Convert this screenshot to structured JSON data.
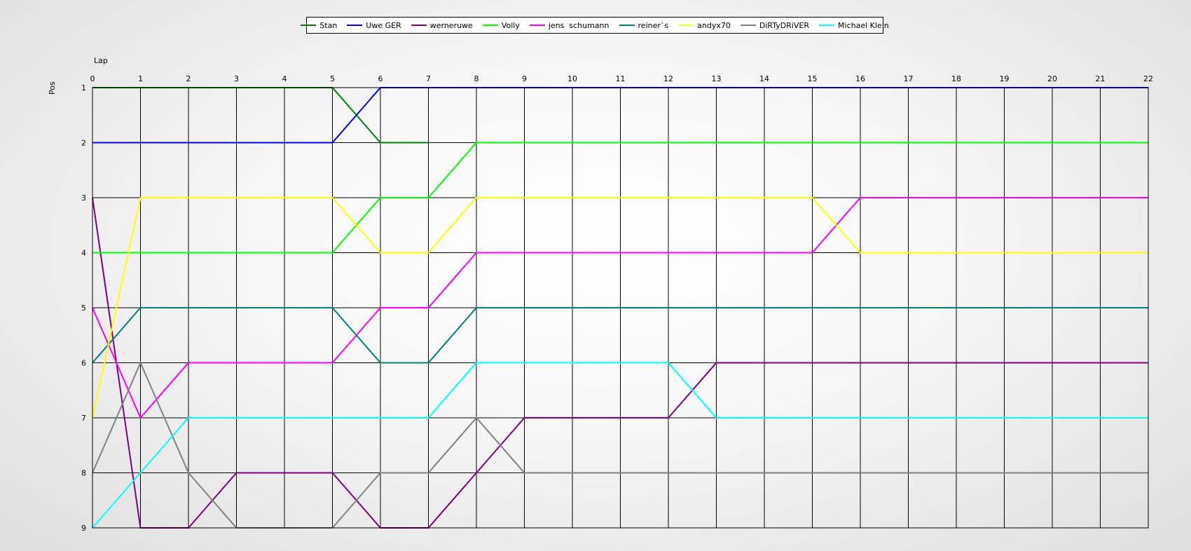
{
  "chart_data": {
    "type": "line",
    "xlabel": "Lap",
    "ylabel": "Pos",
    "x": [
      0,
      1,
      2,
      3,
      4,
      5,
      6,
      7,
      8,
      9,
      10,
      11,
      12,
      13,
      14,
      15,
      16,
      17,
      18,
      19,
      20,
      21,
      22
    ],
    "xlim": [
      0,
      22
    ],
    "ylim": [
      1,
      9
    ],
    "y_inverted": true,
    "y_ticks": [
      1,
      2,
      3,
      4,
      5,
      6,
      7,
      8,
      9
    ],
    "grid": true,
    "legend_position": "top-center",
    "series": [
      {
        "name": "Stan",
        "color": "#008000",
        "values": [
          1,
          1,
          1,
          1,
          1,
          1,
          2,
          2
        ]
      },
      {
        "name": "Uwe GER",
        "color": "#0000ff",
        "values": [
          2,
          2,
          2,
          2,
          2,
          2,
          1,
          1,
          1,
          1,
          1,
          1,
          1,
          1,
          1,
          1,
          1,
          1,
          1,
          1,
          1,
          1,
          1
        ]
      },
      {
        "name": "werneruwe",
        "color": "#800080",
        "values": [
          3,
          9,
          9,
          8,
          8,
          8,
          9,
          9,
          8,
          7,
          7,
          7,
          7,
          6,
          6,
          6,
          6,
          6,
          6,
          6,
          6,
          6,
          6
        ]
      },
      {
        "name": "Volly",
        "color": "#00ff00",
        "values": [
          4,
          4,
          4,
          4,
          4,
          4,
          3,
          3,
          2,
          2,
          2,
          2,
          2,
          2,
          2,
          2,
          2,
          2,
          2,
          2,
          2,
          2,
          2
        ]
      },
      {
        "name": "jens  schumann",
        "color": "#ff00ff",
        "values": [
          5,
          7,
          6,
          6,
          6,
          6,
          5,
          5,
          4,
          4,
          4,
          4,
          4,
          4,
          4,
          4,
          3,
          3,
          3,
          3,
          3,
          3,
          3
        ]
      },
      {
        "name": "reiner`s",
        "color": "#008080",
        "values": [
          6,
          5,
          5,
          5,
          5,
          5,
          6,
          6,
          5,
          5,
          5,
          5,
          5,
          5,
          5,
          5,
          5,
          5,
          5,
          5,
          5,
          5,
          5
        ]
      },
      {
        "name": "andyx70",
        "color": "#ffff00",
        "values": [
          7,
          3,
          3,
          3,
          3,
          3,
          4,
          4,
          3,
          3,
          3,
          3,
          3,
          3,
          3,
          3,
          4,
          4,
          4,
          4,
          4,
          4,
          4
        ]
      },
      {
        "name": "DiRTyDRiVER",
        "color": "#808080",
        "values": [
          8,
          6,
          8,
          9,
          9,
          9,
          8,
          8,
          7,
          8,
          8,
          8,
          8,
          8,
          8,
          8,
          8,
          8,
          8,
          8,
          8,
          8,
          8
        ]
      },
      {
        "name": "Michael Klein",
        "color": "#00ffff",
        "values": [
          9,
          8,
          7,
          7,
          7,
          7,
          7,
          7,
          6,
          6,
          6,
          6,
          6,
          7,
          7,
          7,
          7,
          7,
          7,
          7,
          7,
          7,
          7
        ]
      }
    ]
  }
}
